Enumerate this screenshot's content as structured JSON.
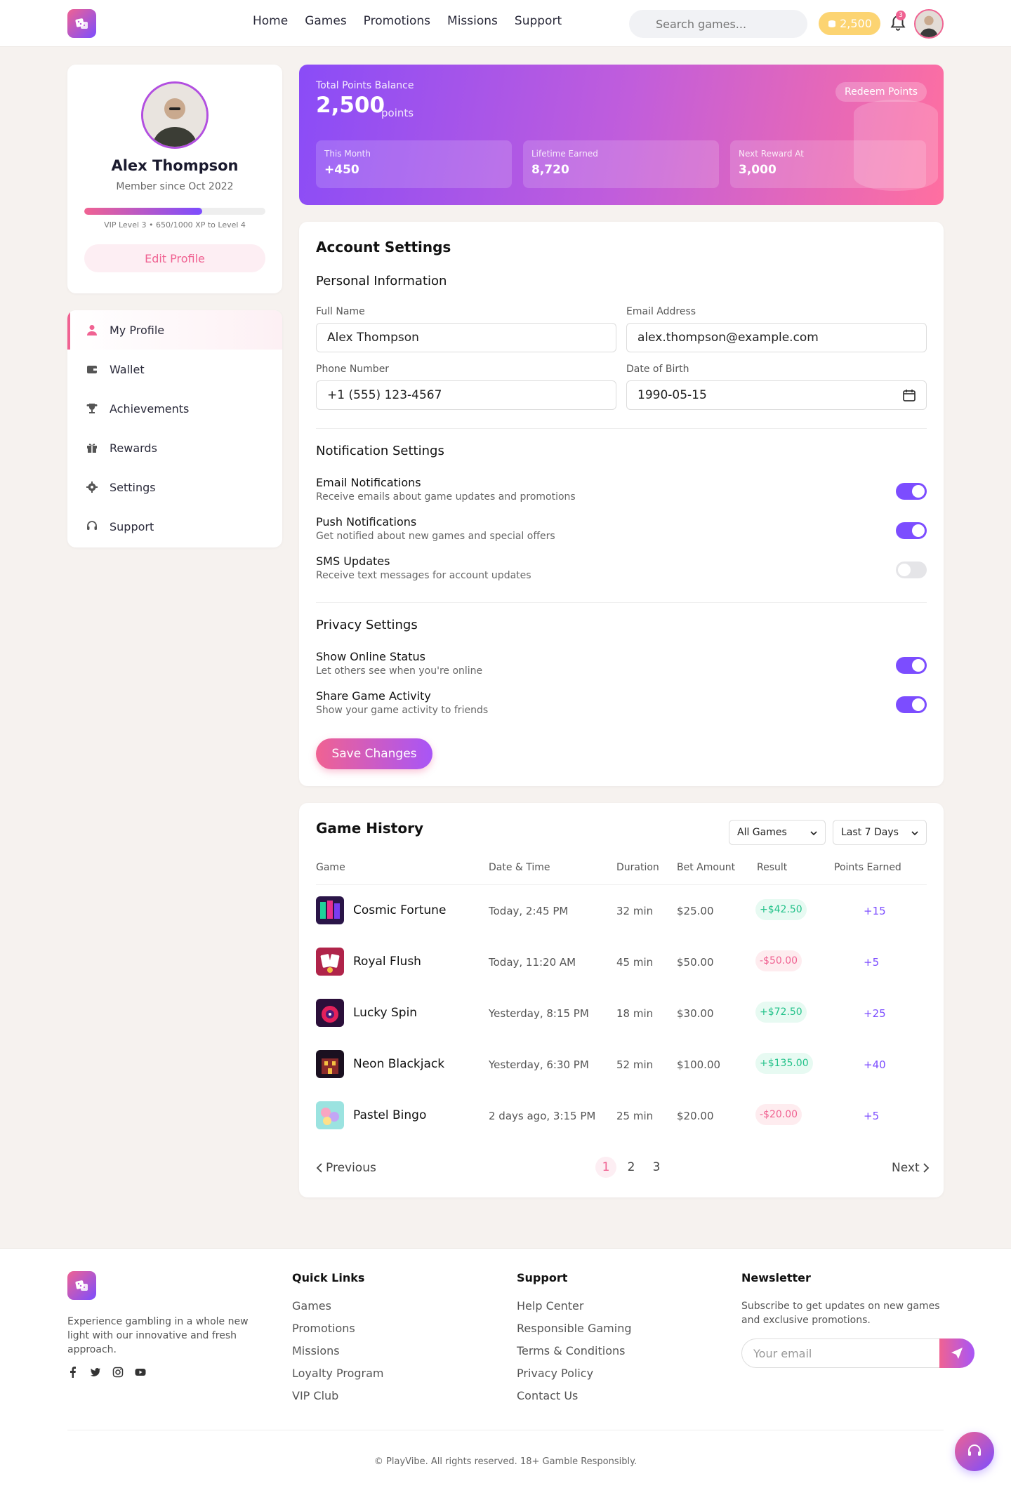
{
  "header": {
    "nav": [
      "Home",
      "Games",
      "Promotions",
      "Missions",
      "Support"
    ],
    "search_placeholder": "Search games...",
    "points": "2,500",
    "notifications_count": "3"
  },
  "profile": {
    "name": "Alex Thompson",
    "member_since": "Member since Oct 2022",
    "xp_label": "VIP Level 3 • 650/1000 XP to Level 4",
    "xp_progress": 0.65,
    "edit_label": "Edit Profile"
  },
  "menu": [
    {
      "label": "My Profile",
      "icon": "user-icon",
      "active": true
    },
    {
      "label": "Wallet",
      "icon": "wallet-icon",
      "active": false
    },
    {
      "label": "Achievements",
      "icon": "trophy-icon",
      "active": false
    },
    {
      "label": "Rewards",
      "icon": "gift-icon",
      "active": false
    },
    {
      "label": "Settings",
      "icon": "gear-icon",
      "active": false
    },
    {
      "label": "Support",
      "icon": "headset-icon",
      "active": false
    }
  ],
  "banner": {
    "label": "Total Points Balance",
    "value": "2,500",
    "unit": "points",
    "redeem_label": "Redeem Points",
    "stats": [
      {
        "label": "This Month",
        "value": "+450"
      },
      {
        "label": "Lifetime Earned",
        "value": "8,720"
      },
      {
        "label": "Next Reward At",
        "value": "3,000"
      }
    ]
  },
  "settings": {
    "title": "Account Settings",
    "personal_title": "Personal Information",
    "fields": {
      "full_name": {
        "label": "Full Name",
        "value": "Alex Thompson"
      },
      "email": {
        "label": "Email Address",
        "value": "alex.thompson@example.com"
      },
      "phone": {
        "label": "Phone Number",
        "value": "+1 (555) 123-4567"
      },
      "dob": {
        "label": "Date of Birth",
        "value": "1990-05-15"
      }
    },
    "notification_title": "Notification Settings",
    "notifications": [
      {
        "title": "Email Notifications",
        "desc": "Receive emails about game updates and promotions",
        "on": true
      },
      {
        "title": "Push Notifications",
        "desc": "Get notified about new games and special offers",
        "on": true
      },
      {
        "title": "SMS Updates",
        "desc": "Receive text messages for account updates",
        "on": false
      }
    ],
    "privacy_title": "Privacy Settings",
    "privacy": [
      {
        "title": "Show Online Status",
        "desc": "Let others see when you're online",
        "on": true
      },
      {
        "title": "Share Game Activity",
        "desc": "Show your game activity to friends",
        "on": true
      }
    ],
    "save_label": "Save Changes"
  },
  "history": {
    "title": "Game History",
    "filter_game": "All Games",
    "filter_period": "Last 7 Days",
    "columns": [
      "Game",
      "Date & Time",
      "Duration",
      "Bet Amount",
      "Result",
      "Points Earned"
    ],
    "rows": [
      {
        "game": "Cosmic Fortune",
        "date": "Today, 2:45 PM",
        "duration": "32 min",
        "bet": "$25.00",
        "result": "+$42.50",
        "win": true,
        "points": "+15"
      },
      {
        "game": "Royal Flush",
        "date": "Today, 11:20 AM",
        "duration": "45 min",
        "bet": "$50.00",
        "result": "-$50.00",
        "win": false,
        "points": "+5"
      },
      {
        "game": "Lucky Spin",
        "date": "Yesterday, 8:15 PM",
        "duration": "18 min",
        "bet": "$30.00",
        "result": "+$72.50",
        "win": true,
        "points": "+25"
      },
      {
        "game": "Neon Blackjack",
        "date": "Yesterday, 6:30 PM",
        "duration": "52 min",
        "bet": "$100.00",
        "result": "+$135.00",
        "win": true,
        "points": "+40"
      },
      {
        "game": "Pastel Bingo",
        "date": "2 days ago, 3:15 PM",
        "duration": "25 min",
        "bet": "$20.00",
        "result": "-$20.00",
        "win": false,
        "points": "+5"
      }
    ],
    "prev_label": "Previous",
    "next_label": "Next",
    "pages": [
      "1",
      "2",
      "3"
    ],
    "current_page": "1"
  },
  "footer": {
    "about": "Experience gambling in a whole new light with our innovative and fresh approach.",
    "quick_links_title": "Quick Links",
    "quick_links": [
      "Games",
      "Promotions",
      "Missions",
      "Loyalty Program",
      "VIP Club"
    ],
    "support_title": "Support",
    "support_links": [
      "Help Center",
      "Responsible Gaming",
      "Terms & Conditions",
      "Privacy Policy",
      "Contact Us"
    ],
    "newsletter_title": "Newsletter",
    "newsletter_desc": "Subscribe to get updates on new games and exclusive promotions.",
    "email_placeholder": "Your email",
    "copyright": "© PlayVibe. All rights reserved. 18+ Gamble Responsibly."
  },
  "colors": {
    "accent_pink": "#f06292",
    "accent_purple": "#7c4dff",
    "gold": "#fcd472",
    "win": "#23c28a"
  }
}
